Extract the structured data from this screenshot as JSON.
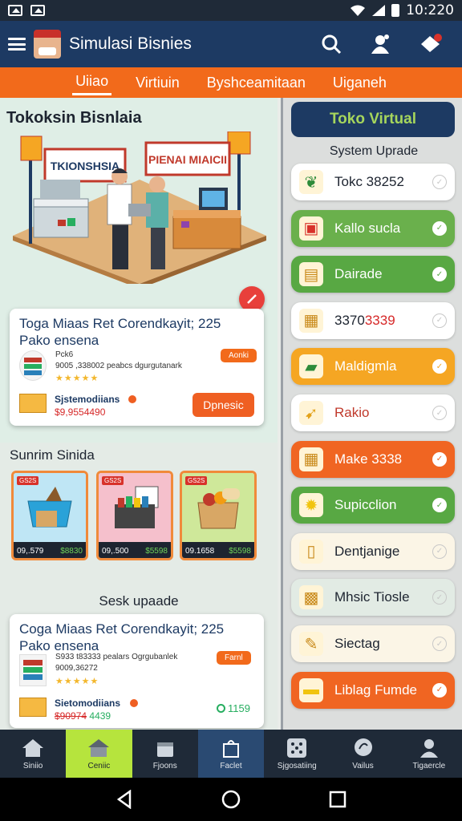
{
  "status_bar": {
    "time": "10:220"
  },
  "app_bar": {
    "title": "Simulasi Bisnies"
  },
  "tabs": [
    {
      "label": "Uiiao"
    },
    {
      "label": "Virtiuin"
    },
    {
      "label": "Byshceamitaan"
    },
    {
      "label": "Uiganeh"
    }
  ],
  "hero": {
    "title": "Tokoksin Bisnlaia",
    "banner_left": "TKIONSHSIA",
    "banner_right": "PIENAI MIAICII"
  },
  "card1": {
    "title": "Toga Miaas Ret Corendkayit; 225",
    "subtitle": "Pako ensena",
    "code": "Pck6",
    "desc": "9005 ,338002 peabcs dgurgutanark",
    "rating": "★★★★★",
    "badge": "Aonki",
    "link": "Sjstemodiians",
    "price": "$9,9554490",
    "button": "Dpnesic"
  },
  "section_products": {
    "title": "Sunrim Sinida",
    "items": [
      {
        "tag": "GS2S",
        "price": "09,.579",
        "green": "$8830",
        "color": "#2aa2d8"
      },
      {
        "tag": "GS2S",
        "price": "09,.500",
        "green": "$5598",
        "color": "#ef7fa0"
      },
      {
        "tag": "GS2S",
        "price": "09.1658",
        "green": "$5598",
        "color": "#9fd34a"
      }
    ]
  },
  "section_update": {
    "title": "Sesk upaade"
  },
  "card2": {
    "title": "Coga Miaas Ret Corendkayit; 225",
    "subtitle": "Pako ensena",
    "desc": "S933 t83333 pealars Ogrgubanlek",
    "desc2": "9009,36272",
    "rating": "★★★★★",
    "badge": "Farnl",
    "link": "Sietomodiians",
    "price": "$90974",
    "price_extra": "4439",
    "counter": "1159"
  },
  "right_panel": {
    "toko_button": "Toko Virtual",
    "heading": "System Uprade",
    "items": [
      {
        "label": "Tokc 38252",
        "icon": "leaf-icon",
        "bg": "#ffffff",
        "fg": "#1d2430"
      },
      {
        "label": "Kallo sucla",
        "icon": "shop-badge-icon",
        "bg": "#6ab04c",
        "fg": "#ffffff"
      },
      {
        "label": "Dairade",
        "icon": "basket-icon",
        "bg": "#58a843",
        "fg": "#ffffff"
      },
      {
        "label": "3370",
        "label_red": "3339",
        "icon": "boxes-icon",
        "bg": "#ffffff",
        "fg": "#1d2430"
      },
      {
        "label": "Maldigmla",
        "icon": "folder-icon",
        "bg": "#f5a623",
        "fg": "#ffffff"
      },
      {
        "label": "Rakio",
        "icon": "horn-icon",
        "bg": "#ffffff",
        "fg": "#c0392b"
      },
      {
        "label": "Make 3338",
        "icon": "calculator-icon",
        "bg": "#f06522",
        "fg": "#ffffff"
      },
      {
        "label": "Supicclion",
        "icon": "lightbulb-icon",
        "bg": "#58a843",
        "fg": "#ffffff"
      },
      {
        "label": "Dentjanige",
        "icon": "device-icon",
        "bg": "#fbf5e6",
        "fg": "#1d2430"
      },
      {
        "label": "Mhsic Tiosle",
        "icon": "grid-icon",
        "bg": "#e2ebe4",
        "fg": "#1d2430"
      },
      {
        "label": "Siectag",
        "icon": "tag-icon",
        "bg": "#fbf5e6",
        "fg": "#1d2430"
      },
      {
        "label": "Liblag Fumde",
        "icon": "wallet-icon",
        "bg": "#f06522",
        "fg": "#ffffff"
      }
    ]
  },
  "bottom_nav": [
    {
      "label": "Siniio",
      "icon": "home-icon"
    },
    {
      "label": "Ceniic",
      "icon": "store-icon"
    },
    {
      "label": "Fjoons",
      "icon": "box-icon"
    },
    {
      "label": "Faclet",
      "icon": "bag-icon"
    },
    {
      "label": "Sjgosatiing",
      "icon": "dots-grid-icon"
    },
    {
      "label": "Vailus",
      "icon": "chat-icon"
    },
    {
      "label": "Tigaercle",
      "icon": "person-icon"
    }
  ]
}
